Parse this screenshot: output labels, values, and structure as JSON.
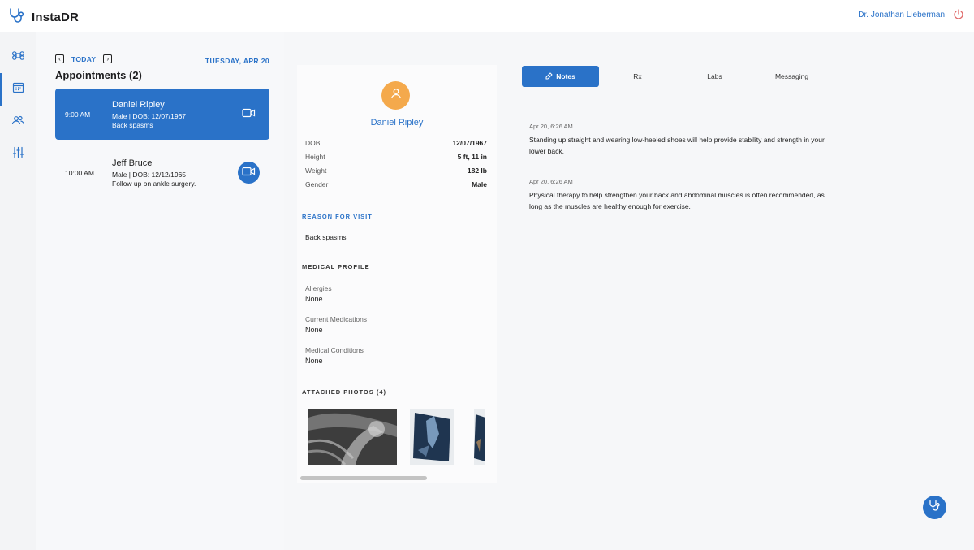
{
  "app": {
    "name": "InstaDR"
  },
  "header": {
    "doctor_name": "Dr. Jonathan Lieberman"
  },
  "rail": {
    "items": [
      {
        "name": "dashboard",
        "icon": "command-icon"
      },
      {
        "name": "calendar",
        "icon": "calendar-icon",
        "active": true
      },
      {
        "name": "patients",
        "icon": "users-icon"
      },
      {
        "name": "settings",
        "icon": "sliders-icon"
      }
    ]
  },
  "schedule": {
    "today_label": "TODAY",
    "date_label": "TUESDAY, APR 20",
    "title": "Appointments (2)",
    "appointments": [
      {
        "time": "9:00 AM",
        "name": "Daniel Ripley",
        "meta": "Male | DOB: 12/07/1967",
        "reason": "Back spasms",
        "active": true
      },
      {
        "time": "10:00 AM",
        "name": "Jeff Bruce",
        "meta": "Male | DOB: 12/12/1965",
        "reason": "Follow up on ankle surgery.",
        "active": false
      }
    ]
  },
  "patient": {
    "name": "Daniel Ripley",
    "vitals": [
      {
        "label": "DOB",
        "value": "12/07/1967"
      },
      {
        "label": "Height",
        "value": "5 ft, 11 in"
      },
      {
        "label": "Weight",
        "value": "182 lb"
      },
      {
        "label": "Gender",
        "value": "Male"
      }
    ],
    "reason_heading": "REASON FOR VISIT",
    "reason": "Back spasms",
    "medical_heading": "MEDICAL PROFILE",
    "medical": [
      {
        "label": "Allergies",
        "value": "None."
      },
      {
        "label": "Current Medications",
        "value": "None"
      },
      {
        "label": "Medical Conditions",
        "value": "None"
      }
    ],
    "photos_heading": "ATTACHED PHOTOS (4)"
  },
  "tabs": [
    {
      "label": "Notes",
      "active": true
    },
    {
      "label": "Rx",
      "active": false
    },
    {
      "label": "Labs",
      "active": false
    },
    {
      "label": "Messaging",
      "active": false
    }
  ],
  "notes": [
    {
      "date": "Apr 20, 6:26 AM",
      "text": "Standing up straight and wearing low-heeled shoes will help provide stability and strength in your lower back."
    },
    {
      "date": "Apr 20, 6:26 AM",
      "text": "Physical therapy to help strengthen your back and abdominal muscles is often recommended, as long as the muscles are healthy enough for exercise."
    }
  ],
  "colors": {
    "accent": "#2a72c8",
    "avatar": "#f4a94c"
  }
}
